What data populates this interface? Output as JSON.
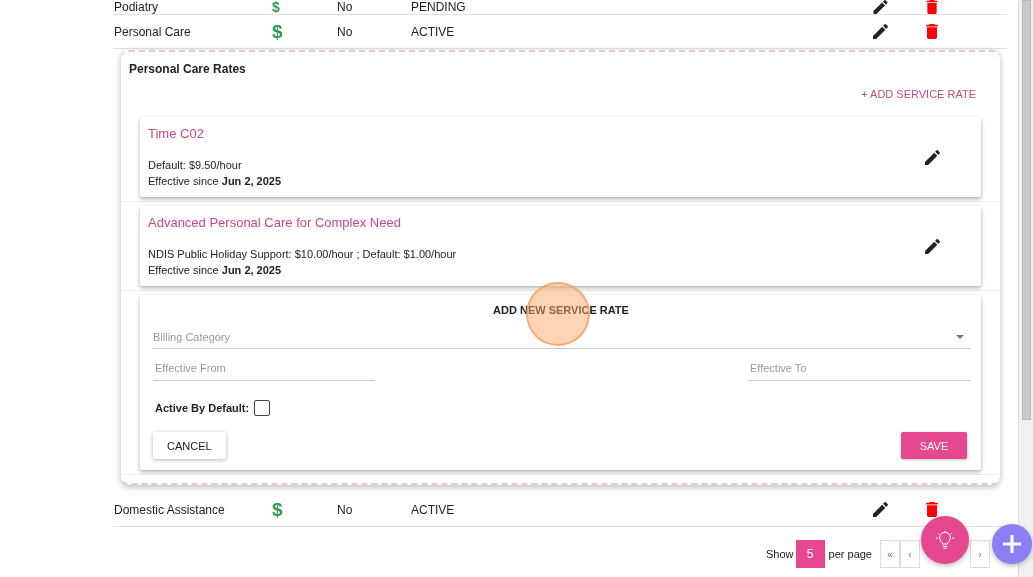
{
  "table": {
    "rows": [
      {
        "column_1": "Podiatry",
        "column_2": "$",
        "column_3": "No",
        "column_4": "PENDING"
      },
      {
        "column_1": "Personal Care",
        "column_2": "$",
        "column_3": "No",
        "column_4": "ACTIVE",
        "rates_panel": {
          "title": "Personal Care Rates",
          "add_link": "+ ADD SERVICE RATE",
          "rates": [
            {
              "name": "Time C02",
              "pricing": "Default: $9.50/hour",
              "effective": "Effective since **Jun 2, 2025**"
            },
            {
              "name": "Advanced Personal Care for Complex Need",
              "pricing": "NDIS Public Holiday Support: $10.00/hour ; Default: $1.00/hour",
              "effective": "Effective since **Jun 2, 2025**"
            }
          ],
          "new_rate_form": {
            "heading": "ADD NEW SERVICE RATE",
            "billing_category": {
              "placeholder": "Billing Category"
            },
            "effective_from": {
              "placeholder": "Effective From"
            },
            "effective_to": {
              "placeholder": "Effective To"
            },
            "active_by_default": {
              "label": "Active By Default:",
              "checked": false
            },
            "buttons": [
              {
                "label": "CANCEL",
                "kind": "secondary"
              },
              {
                "label": "SAVE",
                "kind": "primary"
              }
            ]
          }
        }
      },
      {
        "column_1": "Domestic Assistance",
        "column_2": "$",
        "column_3": "No",
        "column_4": "ACTIVE"
      }
    ]
  },
  "pagination": {
    "show_label": "Show",
    "page_size": "5",
    "per_page_label": "per page",
    "buttons": [
      "«",
      "‹",
      "›"
    ]
  }
}
